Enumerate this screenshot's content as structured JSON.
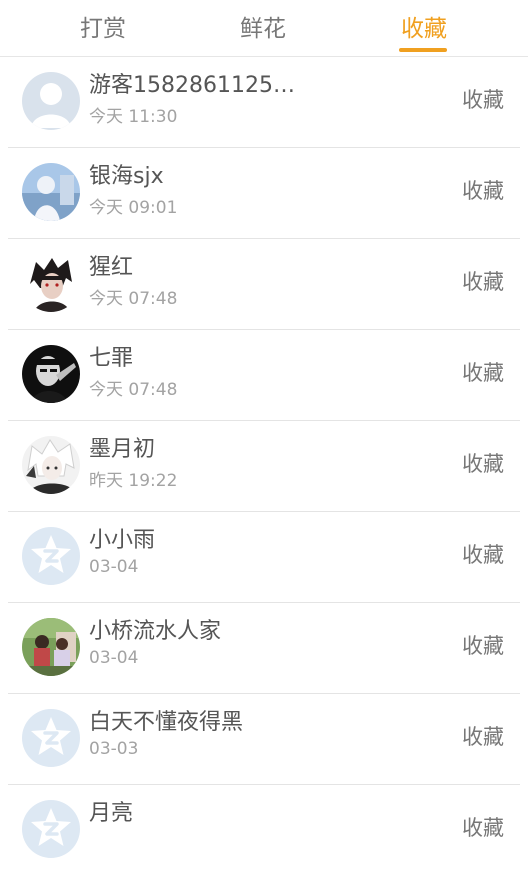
{
  "tabs": [
    {
      "label": "打赏"
    },
    {
      "label": "鲜花"
    },
    {
      "label": "收藏"
    }
  ],
  "accent_color": "#f0a020",
  "items": [
    {
      "name": "游客1582861125…",
      "time": "今天 11:30",
      "action": "收藏",
      "avatar": "default-person-icon"
    },
    {
      "name": "银海sjx",
      "time": "今天 09:01",
      "action": "收藏",
      "avatar": "user-photo"
    },
    {
      "name": "猩红",
      "time": "今天 07:48",
      "action": "收藏",
      "avatar": "user-photo"
    },
    {
      "name": "七罪",
      "time": "今天 07:48",
      "action": "收藏",
      "avatar": "user-photo"
    },
    {
      "name": "墨月初",
      "time": "昨天 19:22",
      "action": "收藏",
      "avatar": "user-photo"
    },
    {
      "name": "小小雨",
      "time": "03-04",
      "action": "收藏",
      "avatar": "default-z-icon"
    },
    {
      "name": "小桥流水人家",
      "time": "03-04",
      "action": "收藏",
      "avatar": "user-photo"
    },
    {
      "name": "白天不懂夜得黑",
      "time": "03-03",
      "action": "收藏",
      "avatar": "default-z-icon"
    },
    {
      "name": "月亮",
      "time": "",
      "action": "收藏",
      "avatar": "default-z-icon"
    }
  ]
}
